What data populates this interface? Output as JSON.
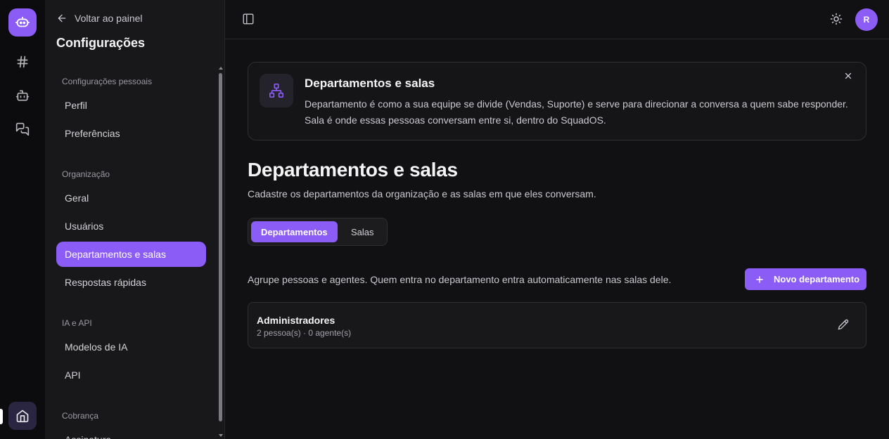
{
  "rail": {
    "items": [
      {
        "icon": "hash-icon"
      },
      {
        "icon": "bot-icon"
      },
      {
        "icon": "chat-icon"
      }
    ],
    "home_icon": "home-icon"
  },
  "sidebar": {
    "back_label": "Voltar ao painel",
    "title": "Configurações",
    "groups": [
      {
        "label": "Configurações pessoais",
        "items": [
          "Perfil",
          "Preferências"
        ]
      },
      {
        "label": "Organização",
        "items": [
          "Geral",
          "Usuários",
          "Departamentos e salas",
          "Respostas rápidas"
        ]
      },
      {
        "label": "IA e API",
        "items": [
          "Modelos de IA",
          "API"
        ]
      },
      {
        "label": "Cobrança",
        "items": [
          "Assinatura"
        ]
      }
    ],
    "active_item": "Departamentos e salas"
  },
  "topbar": {
    "avatar_initial": "R"
  },
  "info": {
    "title": "Departamentos e salas",
    "description": "Departamento é como a sua equipe se divide (Vendas, Suporte) e serve para direcionar a conversa a quem sabe responder. Sala é onde essas pessoas conversam entre si, dentro do SquadOS."
  },
  "page": {
    "title": "Departamentos e salas",
    "subtitle": "Cadastre os departamentos da organização e as salas em que eles conversam.",
    "tabs": [
      "Departamentos",
      "Salas"
    ],
    "active_tab": "Departamentos",
    "list_description": "Agrupe pessoas e agentes. Quem entra no departamento entra automaticamente nas salas dele.",
    "new_button": "Novo departamento"
  },
  "departments": [
    {
      "name": "Administradores",
      "meta": "2 pessoa(s) · 0 agente(s)"
    }
  ],
  "colors": {
    "accent": "#8b5cf6",
    "background": "#111113",
    "sidebar": "#18181b"
  }
}
